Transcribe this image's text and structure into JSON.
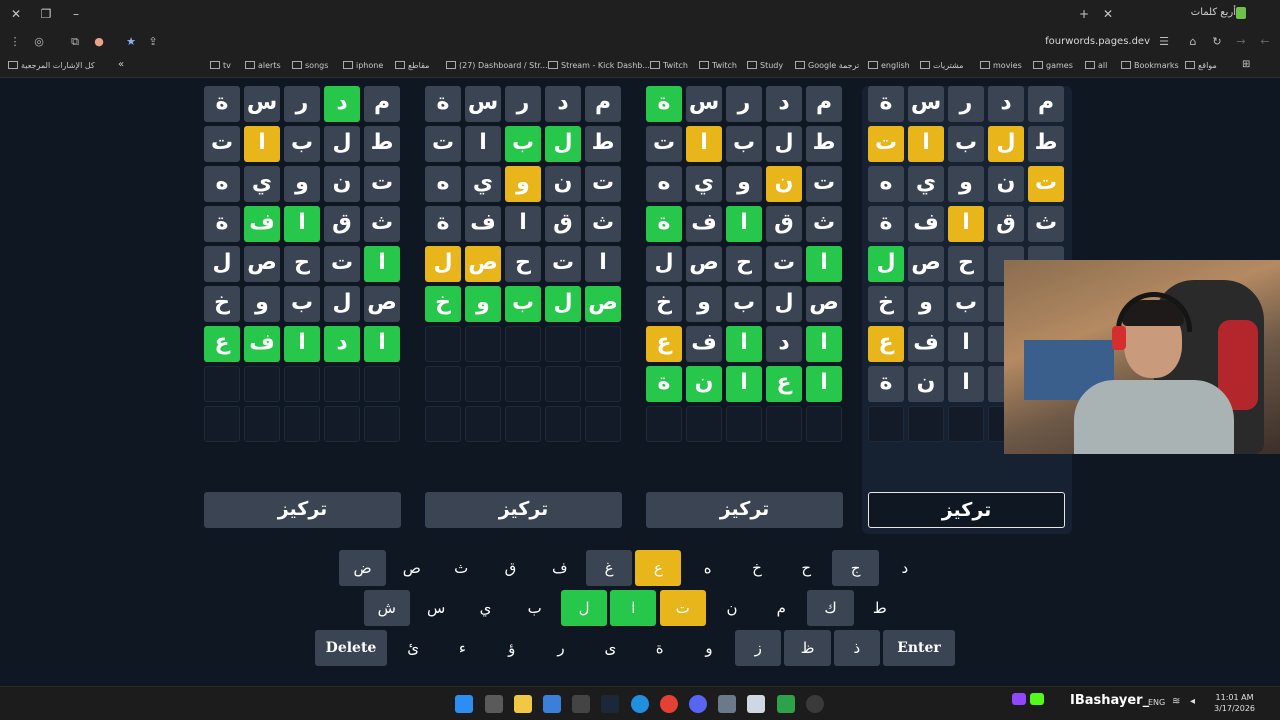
{
  "browser": {
    "tab_title": "أربع كلمات",
    "url": "fourwords.pages.dev",
    "bookmarks": [
      "كل الإشارات المرجعية",
      "tv",
      "alerts",
      "songs",
      "iphone",
      "مقاطع",
      "(27) Dashboard / Str...",
      "Stream - Kick Dashb...",
      "Twitch",
      "Twitch",
      "Study",
      "Google ترجمة",
      "english",
      "مشتريات",
      "movies",
      "games",
      "all",
      "Bookmarks",
      "مواقع"
    ]
  },
  "boards": [
    {
      "rows": [
        [
          [
            "م",
            "gray"
          ],
          [
            "د",
            "green"
          ],
          [
            "ر",
            "gray"
          ],
          [
            "س",
            "gray"
          ],
          [
            "ة",
            "gray"
          ]
        ],
        [
          [
            "ط",
            "gray"
          ],
          [
            "ل",
            "gray"
          ],
          [
            "ب",
            "gray"
          ],
          [
            "ا",
            "yellow"
          ],
          [
            "ت",
            "gray"
          ]
        ],
        [
          [
            "ت",
            "gray"
          ],
          [
            "ن",
            "gray"
          ],
          [
            "و",
            "gray"
          ],
          [
            "ي",
            "gray"
          ],
          [
            "ه",
            "gray"
          ]
        ],
        [
          [
            "ث",
            "gray"
          ],
          [
            "ق",
            "gray"
          ],
          [
            "ا",
            "green"
          ],
          [
            "ف",
            "green"
          ],
          [
            "ة",
            "gray"
          ]
        ],
        [
          [
            "ا",
            "green"
          ],
          [
            "ت",
            "gray"
          ],
          [
            "ح",
            "gray"
          ],
          [
            "ص",
            "gray"
          ],
          [
            "ل",
            "gray"
          ]
        ],
        [
          [
            "ص",
            "gray"
          ],
          [
            "ل",
            "gray"
          ],
          [
            "ب",
            "gray"
          ],
          [
            "و",
            "gray"
          ],
          [
            "خ",
            "gray"
          ]
        ],
        [
          [
            "ا",
            "green"
          ],
          [
            "د",
            "green"
          ],
          [
            "ا",
            "green"
          ],
          [
            "ف",
            "green"
          ],
          [
            "ع",
            "green"
          ]
        ]
      ],
      "focus_label": "تركيز"
    },
    {
      "rows": [
        [
          [
            "م",
            "gray"
          ],
          [
            "د",
            "gray"
          ],
          [
            "ر",
            "gray"
          ],
          [
            "س",
            "gray"
          ],
          [
            "ة",
            "gray"
          ]
        ],
        [
          [
            "ط",
            "gray"
          ],
          [
            "ل",
            "green"
          ],
          [
            "ب",
            "green"
          ],
          [
            "ا",
            "gray"
          ],
          [
            "ت",
            "gray"
          ]
        ],
        [
          [
            "ت",
            "gray"
          ],
          [
            "ن",
            "gray"
          ],
          [
            "و",
            "yellow"
          ],
          [
            "ي",
            "gray"
          ],
          [
            "ه",
            "gray"
          ]
        ],
        [
          [
            "ث",
            "gray"
          ],
          [
            "ق",
            "gray"
          ],
          [
            "ا",
            "gray"
          ],
          [
            "ف",
            "gray"
          ],
          [
            "ة",
            "gray"
          ]
        ],
        [
          [
            "ا",
            "gray"
          ],
          [
            "ت",
            "gray"
          ],
          [
            "ح",
            "gray"
          ],
          [
            "ص",
            "yellow"
          ],
          [
            "ل",
            "yellow"
          ]
        ],
        [
          [
            "ص",
            "green"
          ],
          [
            "ل",
            "green"
          ],
          [
            "ب",
            "green"
          ],
          [
            "و",
            "green"
          ],
          [
            "خ",
            "green"
          ]
        ]
      ],
      "focus_label": "تركيز"
    },
    {
      "rows": [
        [
          [
            "م",
            "gray"
          ],
          [
            "د",
            "gray"
          ],
          [
            "ر",
            "gray"
          ],
          [
            "س",
            "gray"
          ],
          [
            "ة",
            "green"
          ]
        ],
        [
          [
            "ط",
            "gray"
          ],
          [
            "ل",
            "gray"
          ],
          [
            "ب",
            "gray"
          ],
          [
            "ا",
            "yellow"
          ],
          [
            "ت",
            "gray"
          ]
        ],
        [
          [
            "ت",
            "gray"
          ],
          [
            "ن",
            "yellow"
          ],
          [
            "و",
            "gray"
          ],
          [
            "ي",
            "gray"
          ],
          [
            "ه",
            "gray"
          ]
        ],
        [
          [
            "ث",
            "gray"
          ],
          [
            "ق",
            "gray"
          ],
          [
            "ا",
            "green"
          ],
          [
            "ف",
            "gray"
          ],
          [
            "ة",
            "green"
          ]
        ],
        [
          [
            "ا",
            "green"
          ],
          [
            "ت",
            "gray"
          ],
          [
            "ح",
            "gray"
          ],
          [
            "ص",
            "gray"
          ],
          [
            "ل",
            "gray"
          ]
        ],
        [
          [
            "ص",
            "gray"
          ],
          [
            "ل",
            "gray"
          ],
          [
            "ب",
            "gray"
          ],
          [
            "و",
            "gray"
          ],
          [
            "خ",
            "gray"
          ]
        ],
        [
          [
            "ا",
            "green"
          ],
          [
            "د",
            "gray"
          ],
          [
            "ا",
            "green"
          ],
          [
            "ف",
            "gray"
          ],
          [
            "ع",
            "yellow"
          ]
        ],
        [
          [
            "ا",
            "green"
          ],
          [
            "ع",
            "green"
          ],
          [
            "ا",
            "green"
          ],
          [
            "ن",
            "green"
          ],
          [
            "ة",
            "green"
          ]
        ]
      ],
      "focus_label": "تركيز"
    },
    {
      "rows": [
        [
          [
            "م",
            "gray"
          ],
          [
            "د",
            "gray"
          ],
          [
            "ر",
            "gray"
          ],
          [
            "س",
            "gray"
          ],
          [
            "ة",
            "gray"
          ]
        ],
        [
          [
            "ط",
            "gray"
          ],
          [
            "ل",
            "yellow"
          ],
          [
            "ب",
            "gray"
          ],
          [
            "ا",
            "yellow"
          ],
          [
            "ت",
            "yellow"
          ]
        ],
        [
          [
            "ت",
            "yellow"
          ],
          [
            "ن",
            "gray"
          ],
          [
            "و",
            "gray"
          ],
          [
            "ي",
            "gray"
          ],
          [
            "ه",
            "gray"
          ]
        ],
        [
          [
            "ث",
            "gray"
          ],
          [
            "ق",
            "gray"
          ],
          [
            "ا",
            "yellow"
          ],
          [
            "ف",
            "gray"
          ],
          [
            "ة",
            "gray"
          ]
        ],
        [
          [
            "",
            "gray"
          ],
          [
            "",
            "gray"
          ],
          [
            "ح",
            "gray"
          ],
          [
            "ص",
            "gray"
          ],
          [
            "ل",
            "green"
          ]
        ],
        [
          [
            "",
            "gray"
          ],
          [
            "",
            "gray"
          ],
          [
            "ب",
            "gray"
          ],
          [
            "و",
            "gray"
          ],
          [
            "خ",
            "gray"
          ]
        ],
        [
          [
            "",
            "gray"
          ],
          [
            "",
            "gray"
          ],
          [
            "ا",
            "gray"
          ],
          [
            "ف",
            "gray"
          ],
          [
            "ع",
            "yellow"
          ]
        ],
        [
          [
            "",
            "gray"
          ],
          [
            "",
            "gray"
          ],
          [
            "ا",
            "gray"
          ],
          [
            "ن",
            "gray"
          ],
          [
            "ة",
            "gray"
          ]
        ]
      ],
      "focus_label": "تركيز",
      "active": true
    }
  ],
  "keyboard": {
    "row1": [
      [
        "د",
        ""
      ],
      [
        "ج",
        "used"
      ],
      [
        "ح",
        ""
      ],
      [
        "خ",
        ""
      ],
      [
        "ه",
        ""
      ],
      [
        "ع",
        "yellow"
      ],
      [
        "غ",
        "used"
      ],
      [
        "ف",
        ""
      ],
      [
        "ق",
        ""
      ],
      [
        "ث",
        ""
      ],
      [
        "ص",
        ""
      ],
      [
        "ض",
        "used"
      ]
    ],
    "row2": [
      [
        "ط",
        ""
      ],
      [
        "ك",
        "used"
      ],
      [
        "م",
        ""
      ],
      [
        "ن",
        ""
      ],
      [
        "ت",
        "yellow"
      ],
      [
        "ا",
        "green"
      ],
      [
        "ل",
        "green"
      ],
      [
        "ب",
        ""
      ],
      [
        "ي",
        ""
      ],
      [
        "س",
        ""
      ],
      [
        "ش",
        "used"
      ]
    ],
    "row3": [
      [
        "Enter",
        "wide"
      ],
      [
        "ذ",
        "used"
      ],
      [
        "ظ",
        "used"
      ],
      [
        "ز",
        "used"
      ],
      [
        "و",
        ""
      ],
      [
        "ة",
        ""
      ],
      [
        "ى",
        ""
      ],
      [
        "ر",
        ""
      ],
      [
        "ؤ",
        ""
      ],
      [
        "ء",
        ""
      ],
      [
        "ئ",
        ""
      ],
      [
        "Delete",
        "wide"
      ]
    ]
  },
  "taskbar": {
    "streamer": "IBashayer_",
    "lang": "ENG",
    "time": "11:01 AM",
    "date": "3/17/2026"
  },
  "colors": {
    "green": "#26c74a",
    "yellow": "#e8b51a",
    "gray": "#3a4452",
    "background": "#0f1722"
  }
}
